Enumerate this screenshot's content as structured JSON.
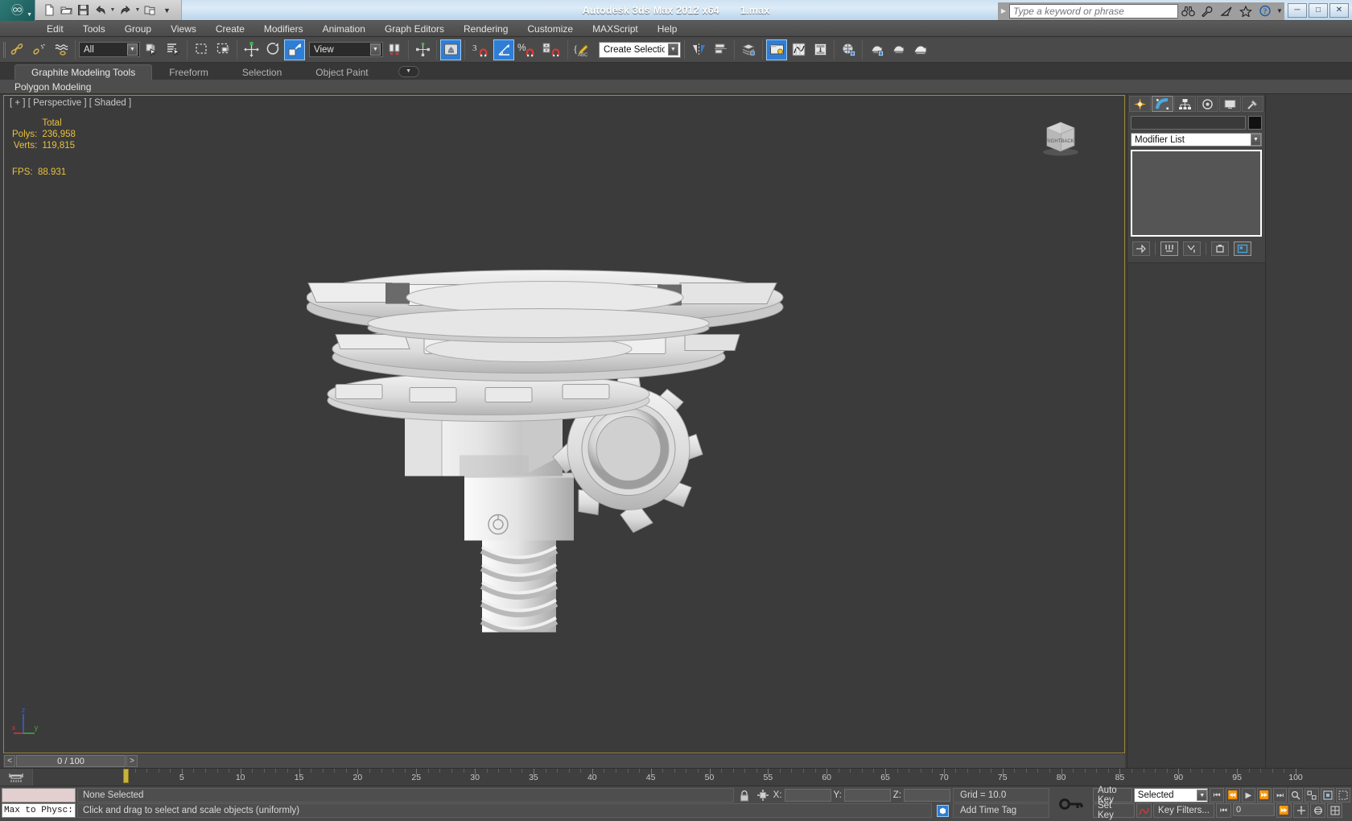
{
  "titlebar": {
    "app_title": "Autodesk 3ds Max  2012 x64",
    "file_name": "1.max",
    "quick_access": [
      "new-file-icon",
      "open-file-icon",
      "save-file-icon",
      "undo-icon",
      "undo-dropdown",
      "redo-icon",
      "redo-dropdown",
      "project-folder-icon",
      "qat-overflow-icon"
    ],
    "search_placeholder": "Type a keyword or phrase",
    "search_value": "",
    "help_icons": [
      "binoculars-icon",
      "wrench-icon",
      "satellite-dish-icon",
      "star-icon",
      "help-icon",
      "help-dropdown-icon"
    ],
    "window_buttons": [
      "minimize",
      "maximize",
      "close"
    ]
  },
  "menubar": {
    "items": [
      "Edit",
      "Tools",
      "Group",
      "Views",
      "Create",
      "Modifiers",
      "Animation",
      "Graph Editors",
      "Rendering",
      "Customize",
      "MAXScript",
      "Help"
    ]
  },
  "toolbar": {
    "selection_filter": "All",
    "reference_coord": "View",
    "named_selection_set": "Create Selection Se",
    "snap_count_label": "3",
    "percent_label": "%",
    "buttons": [
      "select-link-icon",
      "unlink-selection-icon",
      "bind-to-space-warp-icon",
      "select-object-icon",
      "select-by-name-icon",
      "rectangular-selection-region-icon",
      "window-crossing-icon",
      "select-and-move-icon",
      "select-and-rotate-icon",
      "select-and-uniform-scale-icon",
      "mirror-icon",
      "align-icon",
      "use-pivot-point-center-icon",
      "snaps-toggle-icon",
      "angle-snap-toggle-icon",
      "percent-snap-toggle-icon",
      "spinner-snap-toggle-icon",
      "edit-named-selection-sets-icon",
      "mirror-tool-icon",
      "align-tool-icon",
      "layer-manager-icon",
      "graphite-toggle-icon",
      "curve-editor-icon",
      "schematic-view-icon",
      "material-editor-icon",
      "render-setup-icon",
      "render-frame-window-icon",
      "render-production-icon"
    ]
  },
  "ribbon": {
    "tabs": [
      {
        "label": "Graphite Modeling Tools",
        "selected": true
      },
      {
        "label": "Freeform",
        "selected": false
      },
      {
        "label": "Selection",
        "selected": false
      },
      {
        "label": "Object Paint",
        "selected": false
      }
    ],
    "overflow_icon": "ribbon-overflow-icon",
    "panel_title": "Polygon Modeling"
  },
  "viewport": {
    "label": "[ + ] [ Perspective ] [ Shaded ]",
    "stats": {
      "column_header": "Total",
      "rows": [
        {
          "label": "Polys:",
          "value": "236,958"
        },
        {
          "label": "Verts:",
          "value": "119,815"
        }
      ],
      "fps_label": "FPS:",
      "fps_value": "88.931"
    },
    "axis_labels": {
      "x": "x",
      "y": "y",
      "z": "z"
    },
    "viewcube_faces": {
      "left": "RIGHT",
      "right": "BACK"
    },
    "model_description": "shaded-mechanical-gear-assembly"
  },
  "time_slider": {
    "prev_label": "<",
    "next_label": ">",
    "frame_display": "0 / 100"
  },
  "track_bar": {
    "ticks": [
      "5",
      "10",
      "15",
      "20",
      "25",
      "30",
      "35",
      "40",
      "45",
      "50",
      "55",
      "60",
      "65",
      "70",
      "75",
      "80",
      "85",
      "90",
      "95",
      "100"
    ],
    "playhead_frame": 0,
    "key_mode_icon": "open-mini-curve-editor-icon"
  },
  "command_panel": {
    "tabs": [
      {
        "name": "create-tab",
        "icon": "create-star-icon",
        "selected": false
      },
      {
        "name": "modify-tab",
        "icon": "modify-curve-icon",
        "selected": true
      },
      {
        "name": "hierarchy-tab",
        "icon": "hierarchy-icon",
        "selected": false
      },
      {
        "name": "motion-tab",
        "icon": "motion-wheel-icon",
        "selected": false
      },
      {
        "name": "display-tab",
        "icon": "display-monitor-icon",
        "selected": false
      },
      {
        "name": "utilities-tab",
        "icon": "utilities-hammer-icon",
        "selected": false
      }
    ],
    "object_name": "",
    "object_color": "#0d0d0d",
    "modifier_list_label": "Modifier List",
    "stack_items": [],
    "stack_buttons": [
      "pin-stack-icon",
      "show-end-result-icon",
      "make-unique-icon",
      "remove-modifier-icon",
      "configure-modifier-sets-icon"
    ]
  },
  "status_bar": {
    "maxscript_listener_top": "",
    "maxscript_listener_bottom": "Max to Physc:",
    "selection_status": "None Selected",
    "prompt": "Click and drag to select and scale objects (uniformly)",
    "lock_icon": "selection-lock-icon",
    "absolute_mode_icon": "absolute-relative-transform-icon",
    "coords": [
      {
        "axis": "X:",
        "value": ""
      },
      {
        "axis": "Y:",
        "value": ""
      },
      {
        "axis": "Z:",
        "value": ""
      }
    ],
    "grid_label": "Grid = 10.0",
    "add_time_tag": "Add Time Tag",
    "key_icon": "key-mode-toggle-icon",
    "adaptive_degradation_icon": "adaptive-degradation-icon",
    "auto_key_label": "Auto Key",
    "set_key_label": "Set Key",
    "key_filter_selected": "Selected",
    "key_filters_label": "Key Filters...",
    "key_filters_icon": "key-filters-curve-icon",
    "playback_buttons": [
      "goto-start-icon",
      "previous-frame-icon",
      "play-animation-icon",
      "next-frame-icon",
      "goto-end-icon"
    ],
    "current_frame": "0",
    "nav_buttons": [
      "zoom-icon",
      "zoom-all-icon",
      "zoom-extents-icon",
      "zoom-region-icon",
      "pan-view-icon",
      "orbit-icon",
      "maximize-viewport-toggle-icon"
    ]
  },
  "colors": {
    "viewport_border": "#a08a3a",
    "stat_text": "#e8c13c",
    "accent_blue": "#2e7ed6",
    "panel_bg": "#4a4a4a",
    "viewport_bg": "#3b3b3b"
  }
}
